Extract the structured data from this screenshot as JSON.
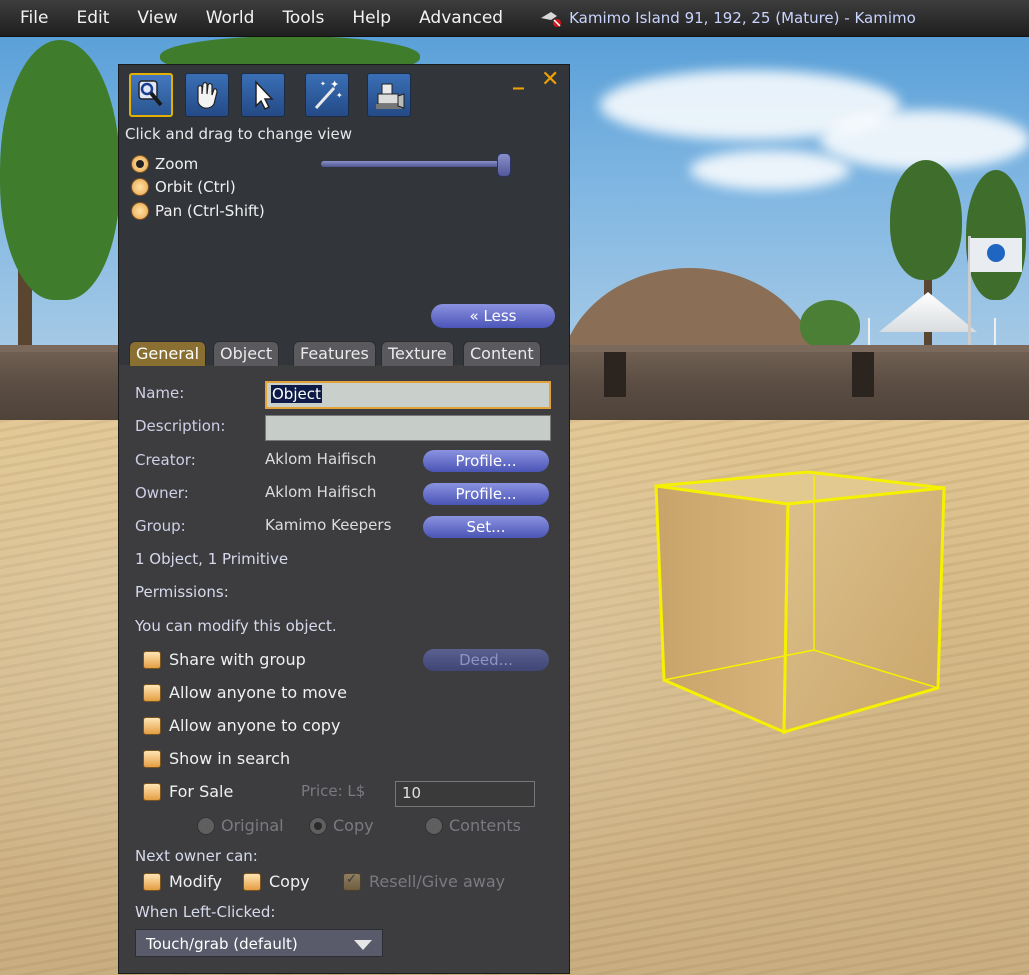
{
  "menubar": {
    "items": [
      "File",
      "Edit",
      "View",
      "World",
      "Tools",
      "Help",
      "Advanced"
    ],
    "location": "Kamimo Island 91, 192, 25 (Mature) - Kamimo"
  },
  "tools": {
    "hint": "Click and drag to change view",
    "view_modes": [
      {
        "label": "Zoom",
        "selected": true
      },
      {
        "label": "Orbit (Ctrl)",
        "selected": false
      },
      {
        "label": "Pan (Ctrl-Shift)",
        "selected": false
      }
    ],
    "less_label": "« Less",
    "tabs": [
      "General",
      "Object",
      "Features",
      "Texture",
      "Content"
    ],
    "active_tab": "General"
  },
  "general": {
    "name_label": "Name:",
    "name_value": "Object",
    "description_label": "Description:",
    "description_value": "",
    "creator_label": "Creator:",
    "creator_value": "Aklom Haifisch",
    "owner_label": "Owner:",
    "owner_value": "Aklom Haifisch",
    "group_label": "Group:",
    "group_value": "Kamimo Keepers",
    "profile_label": "Profile...",
    "set_label": "Set...",
    "deed_label": "Deed...",
    "object_count": "1 Object, 1 Primitive",
    "permissions_label": "Permissions:",
    "modify_note": "You can modify this object.",
    "share_group": "Share with group",
    "allow_move": "Allow anyone to move",
    "allow_copy": "Allow anyone to copy",
    "show_search": "Show in search",
    "for_sale": "For Sale",
    "price_label": "Price: L$",
    "price_value": "10",
    "sale_types": [
      "Original",
      "Copy",
      "Contents"
    ],
    "next_owner_label": "Next owner can:",
    "next_modify": "Modify",
    "next_copy": "Copy",
    "next_resell": "Resell/Give away",
    "left_click_label": "When Left-Clicked:",
    "left_click_value": "Touch/grab (default)"
  },
  "colors": {
    "accent": "#e4b000",
    "button": "#6a74d0",
    "panel": "#3d3d3f"
  }
}
